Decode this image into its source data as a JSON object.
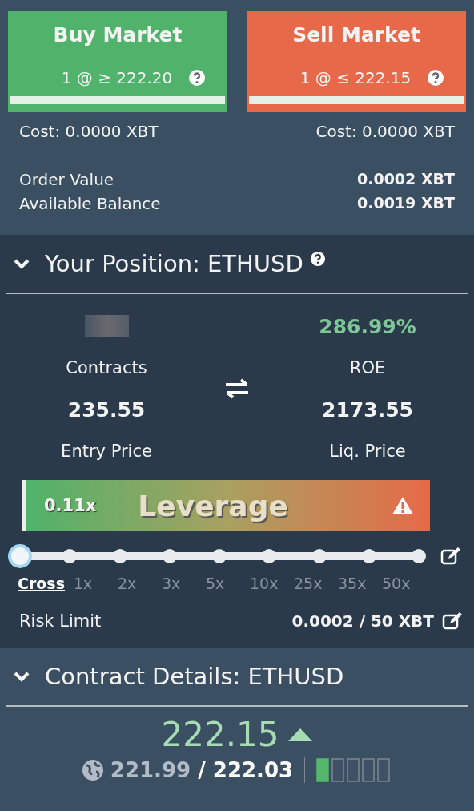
{
  "order_buttons": [
    {
      "kind": "buy",
      "label": "Buy Market",
      "quote": "1 @ ≥ 222.20",
      "cost": "Cost: 0.0000 XBT"
    },
    {
      "kind": "sell",
      "label": "Sell Market",
      "quote": "1 @ ≤ 222.15",
      "cost": "Cost: 0.0000 XBT"
    }
  ],
  "summary": [
    {
      "label": "Order Value",
      "value": "0.0002 XBT"
    },
    {
      "label": "Available Balance",
      "value": "0.0019 XBT"
    }
  ],
  "position": {
    "title": "Your Position: ETHUSD",
    "expanded": true,
    "roe": "286.99%",
    "contracts_label": "Contracts",
    "roe_label": "ROE",
    "entry_price": "235.55",
    "entry_label": "Entry Price",
    "liq_price": "2173.55",
    "liq_label": "Liq. Price",
    "leverage": {
      "value": "0.11x",
      "label": "Leverage"
    },
    "stops": [
      {
        "label": "Cross",
        "selected": true
      },
      {
        "label": "1x",
        "selected": false
      },
      {
        "label": "2x",
        "selected": false
      },
      {
        "label": "3x",
        "selected": false
      },
      {
        "label": "5x",
        "selected": false
      },
      {
        "label": "10x",
        "selected": false
      },
      {
        "label": "25x",
        "selected": false
      },
      {
        "label": "35x",
        "selected": false
      },
      {
        "label": "50x",
        "selected": false
      }
    ],
    "risk_label": "Risk Limit",
    "risk_value": "0.0002 / 50 XBT"
  },
  "contract": {
    "title": "Contract Details: ETHUSD",
    "expanded": true,
    "last_price": "222.15",
    "price_up": true,
    "index_price": "221.99",
    "separator": "/",
    "mark_price": "222.03"
  }
}
